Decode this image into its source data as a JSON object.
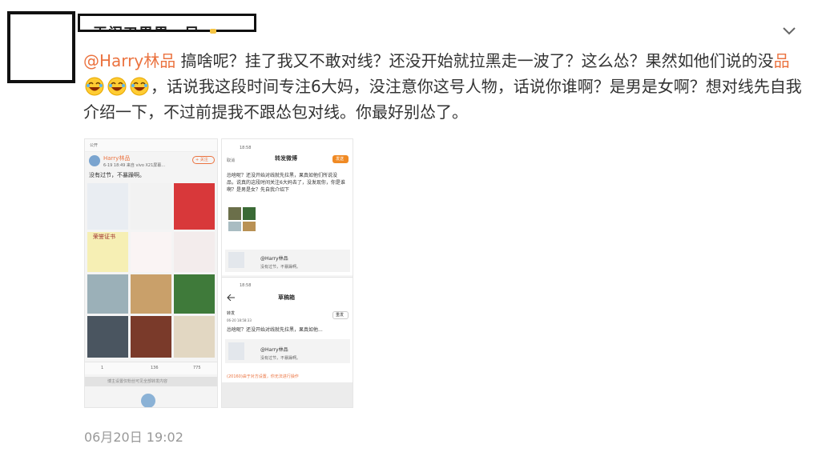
{
  "post": {
    "author_name_partial": "王闹刃男男一尺",
    "mention": "@Harry林品",
    "text_before_emojis": "搞啥呢？挂了我又不敢对线？还没开始就拉黑走一波了？这么怂？果然如他们说的没",
    "highlight": "品",
    "text_after_emojis": "，话说我这段时间专注6大妈，没注意你这号人物，话说你谁啊？是男是女啊？想对线先自我介绍一下，不过前提我不跟怂包对线。你最好别怂了。",
    "timestamp": "06月20日 19:02",
    "emoji_count": 3
  },
  "left_screenshot": {
    "header_label": "公开",
    "user_name": "Harry林品",
    "meta": "6-19 18:49 来自 vivo X21屏幕...",
    "follow": "+ 关注",
    "caption": "没有过节，不暴躁啊。",
    "certificate_label": "荣誉证书",
    "repost_count": "1",
    "comment_count": "136",
    "like_count": "775",
    "footer_note": "博主设置仅粉丝可见全部转发内容"
  },
  "right_screenshot": {
    "top": {
      "time": "18:58",
      "title": "转发微博",
      "cancel": "取消",
      "send": "发送",
      "body": "怂啥呢？还没开始对线就先拉黑，果真如他们所说没品，说真的这段时间关注6大妈去了，没发现你，你是谁啊？是男是女？先自我介绍下",
      "quoted_user": "@Harry林品",
      "quoted_text": "没有过节，不暴躁啊。"
    },
    "bottom": {
      "time": "18:58",
      "title": "草稿箱",
      "item_label": "转发",
      "item_date": "06-20 18:58:33",
      "retry": "重发",
      "body": "怂啥呢？还没开始对线就先拉黑，果真如他...",
      "quoted_user": "@Harry林品",
      "quoted_text": "没有过节，不暴躁啊。",
      "error": "(20160)由于对方设置，你无法进行操作"
    }
  },
  "colors": {
    "mention": "#eb7340",
    "text": "#333333",
    "timestamp": "#999999",
    "redaction": "#111111"
  },
  "icons": [
    "chevron-down-icon",
    "laughing-emoji-icon"
  ]
}
